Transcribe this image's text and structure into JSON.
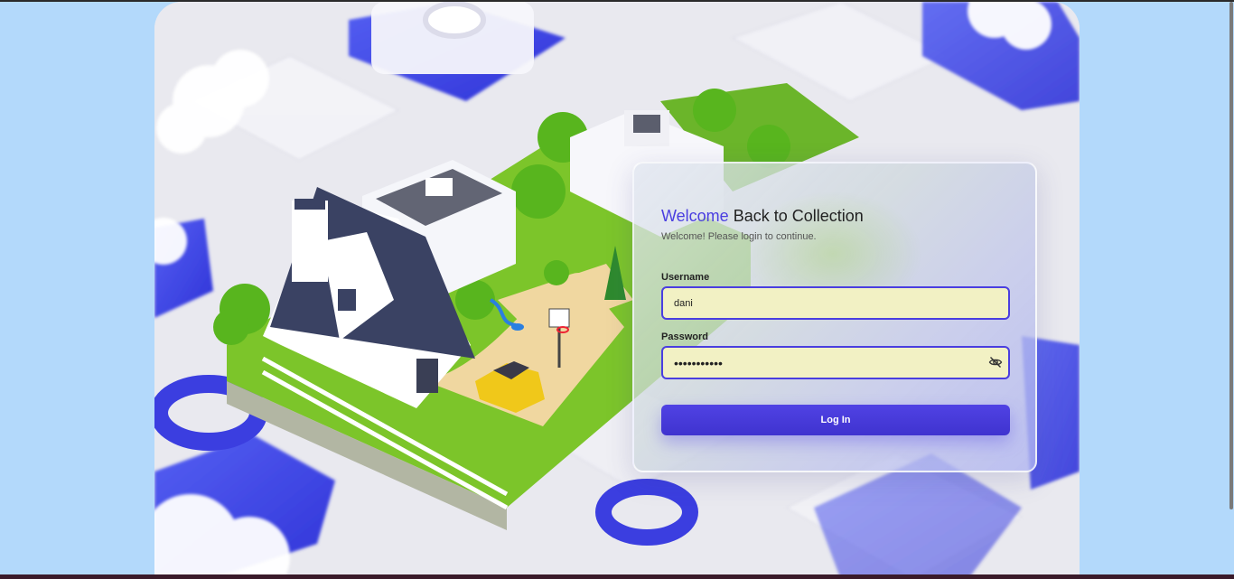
{
  "login": {
    "title_accent": "Welcome",
    "title_rest": " Back to Collection",
    "subtitle": "Welcome! Please login to continue.",
    "username_label": "Username",
    "username_value": "dani",
    "password_label": "Password",
    "password_value": "•••••••••••",
    "login_button": "Log In",
    "password_toggle_icon": "eye-off-icon"
  },
  "colors": {
    "accent": "#4a3ee0",
    "page_background": "#b3d9fb",
    "input_fill": "#f2f1c4",
    "button": "#4a3ee0"
  }
}
